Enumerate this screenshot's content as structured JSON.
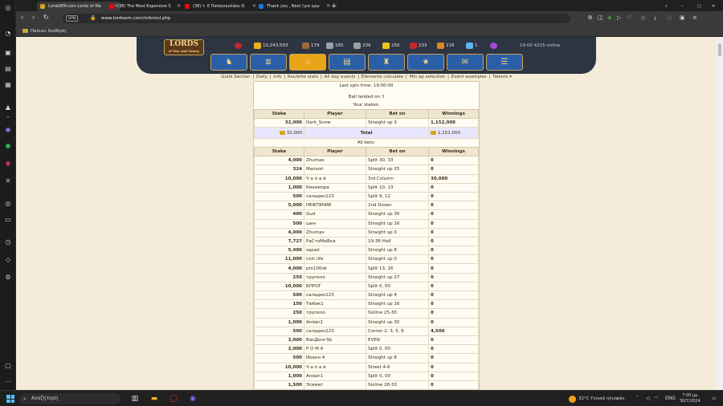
{
  "browser": {
    "tabs": [
      {
        "label": "LordsWM.com Lords of Wa",
        "active": true,
        "color": "#d9a520"
      },
      {
        "label": "(38) The Most Expensive S",
        "active": false,
        "color": "#ff0000"
      },
      {
        "label": "(38) τ. Ε Παπανικολάου Ο",
        "active": false,
        "color": "#ff0000"
      },
      {
        "label": "Thank you , Next (για ερω",
        "active": false,
        "color": "#1877f2"
      }
    ],
    "new_tab": "+",
    "url_badge": "VPN",
    "url": "www.lordswm.com/inforoul.php",
    "bookmark_folder": "Παλιοιι διαθηση"
  },
  "game": {
    "logo_title": "LORDS",
    "logo_subtitle": "of War and Money",
    "resources": [
      {
        "name": "hp",
        "value": "",
        "color": "#c0282d"
      },
      {
        "name": "gold",
        "value": "10,243,593",
        "color": "#e8b31f"
      },
      {
        "name": "wood",
        "value": "179",
        "color": "#9c6b3a"
      },
      {
        "name": "ore",
        "value": "165",
        "color": "#9aa0a6"
      },
      {
        "name": "mercury",
        "value": "239",
        "color": "#9aa0a6"
      },
      {
        "name": "sulfur",
        "value": "256",
        "color": "#e8c51f"
      },
      {
        "name": "crystals",
        "value": "233",
        "color": "#c0282d"
      },
      {
        "name": "gems",
        "value": "216",
        "color": "#d98a1f"
      },
      {
        "name": "diamonds",
        "value": "1",
        "color": "#5ab4f0"
      }
    ],
    "online": "19:00 4215 online",
    "nav_icons": [
      "knight-icon",
      "scroll-icon",
      "swords-icon",
      "map-icon",
      "castle-icon",
      "guild-icon",
      "letter-icon",
      "chat-icon"
    ],
    "submenu": [
      "Guild Section",
      "Daily",
      "Info",
      "Roulette stats",
      "All day events",
      "Elements calculate",
      "Min ap selection",
      "Event examples",
      "Talents ▾"
    ]
  },
  "roulette": {
    "last_spin": "Last spin time: 19:00:00",
    "ball_text": "Ball landed on ",
    "ball_number": "3",
    "your_stakes": "Your stakes:",
    "all_bets": "All bets:",
    "headers": [
      "Stake",
      "Player",
      "Bet on",
      "Winnings"
    ],
    "my_bets": [
      {
        "stake": "32,000",
        "player": "Dark_Snow",
        "bet": "Straight up 3",
        "win": "1,152,000"
      }
    ],
    "total": {
      "stake": "32,000",
      "label": "Total",
      "win": "1,152,000"
    },
    "bets": [
      {
        "stake": "4,000",
        "player": "Zhumax",
        "bet": "Split 30, 33",
        "win": "0"
      },
      {
        "stake": "324",
        "player": "Mansori",
        "bet": "Straight up 25",
        "win": "0"
      },
      {
        "stake": "10,000",
        "player": "Ч а п а й",
        "bet": "3rd Column",
        "win": "30,000"
      },
      {
        "stake": "1,000",
        "player": "Кикимора",
        "bet": "Split 10, 13",
        "win": "0"
      },
      {
        "stake": "500",
        "player": "саладин123",
        "bet": "Split 9, 12",
        "win": "0"
      },
      {
        "stake": "5,000",
        "player": "НЕФТЯНИК",
        "bet": "2nd Dozen",
        "win": "0"
      },
      {
        "stake": "400",
        "player": "Gud",
        "bet": "Straight up 30",
        "win": "0"
      },
      {
        "stake": "500",
        "player": "шин",
        "bet": "Straight up 16",
        "win": "0"
      },
      {
        "stake": "4,000",
        "player": "Zhumax",
        "bet": "Straight up 0",
        "win": "0"
      },
      {
        "stake": "7,727",
        "player": "РаСтоМаФка",
        "bet": "19-36 Half",
        "win": "0"
      },
      {
        "stake": "5,400",
        "player": "sapad",
        "bet": "Straight up 8",
        "win": "0"
      },
      {
        "stake": "11,000",
        "player": "nick life",
        "bet": "Straight up 0",
        "win": "0"
      },
      {
        "stake": "4,000",
        "player": "pro100ok",
        "bet": "Split 13, 16",
        "win": "0"
      },
      {
        "stake": "250",
        "player": "трупело",
        "bet": "Straight up 27",
        "win": "0"
      },
      {
        "stake": "10,000",
        "player": "БПРОГ",
        "bet": "Split 0, 00",
        "win": "0"
      },
      {
        "stake": "500",
        "player": "саладин123",
        "bet": "Straight up 4",
        "win": "0"
      },
      {
        "stake": "150",
        "player": "Тюбик1",
        "bet": "Straight up 16",
        "win": "0"
      },
      {
        "stake": "250",
        "player": "трупело",
        "bet": "Sixline 25-30",
        "win": "0"
      },
      {
        "stake": "1,000",
        "player": "Andan1",
        "bet": "Straight up 30",
        "win": "0"
      },
      {
        "stake": "500",
        "player": "саладин123",
        "bet": "Corner 2, 3, 5, 6",
        "win": "4,500"
      },
      {
        "stake": "3,000",
        "player": "ВанДонгЭр",
        "bet": "EVEN",
        "win": "0"
      },
      {
        "stake": "2,000",
        "player": "Р О М А",
        "bet": "Split 0, 00",
        "win": "0"
      },
      {
        "stake": "500",
        "player": "Иоанн 4",
        "bet": "Straight up 8",
        "win": "0"
      },
      {
        "stake": "10,000",
        "player": "Ч а п а й",
        "bet": "Street 4-6",
        "win": "0"
      },
      {
        "stake": "1,000",
        "player": "Andan1",
        "bet": "Split 0, 00",
        "win": "0"
      },
      {
        "stake": "1,500",
        "player": "Эсимит",
        "bet": "Sixline 28-33",
        "win": "0"
      }
    ]
  },
  "taskbar": {
    "search": "Αναζήτηση",
    "weather": "32°C  Γενικά ηλιοφάν.",
    "lang": "ENG",
    "time": "7:00 μμ",
    "date": "30/7/2024"
  }
}
